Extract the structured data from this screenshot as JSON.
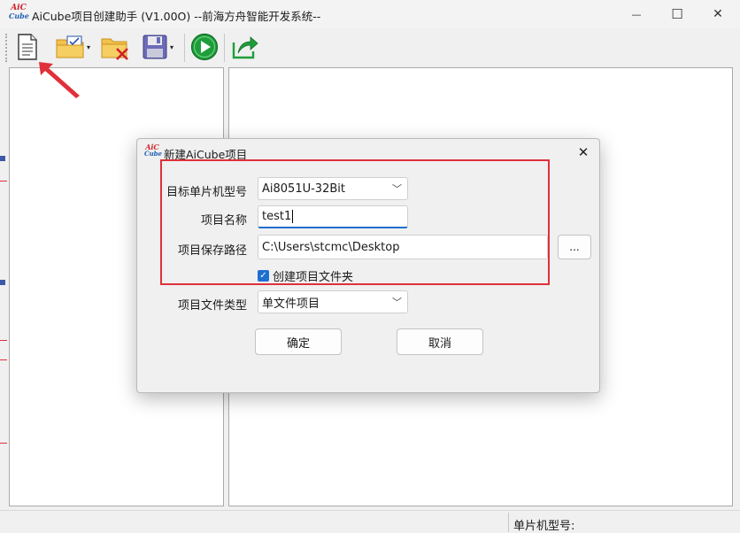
{
  "window": {
    "title": "AiCube项目创建助手 (V1.00O) --前海方舟智能开发系统--",
    "logo_text_top": "AiC",
    "logo_text_bottom": "Cube",
    "minimize_glyph": "—",
    "maximize_glyph": "☐",
    "close_glyph": "✕"
  },
  "toolbar": {
    "icons": [
      "new-file-icon",
      "open-folder-icon",
      "delete-folder-icon",
      "save-icon",
      "run-icon",
      "export-icon"
    ],
    "dropdown_glyph": "▾",
    "accent_green": "#1e9e3a",
    "folder_yellow": "#f2c14e"
  },
  "dialog": {
    "title": "新建AiCube项目",
    "logo_text_top": "AiC",
    "logo_text_bottom": "Cube",
    "close_glyph": "✕",
    "fields": {
      "target_mcu_label": "目标单片机型号",
      "target_mcu_value": "Ai8051U-32Bit",
      "project_name_label": "项目名称",
      "project_name_value": "test1",
      "save_path_label": "项目保存路径",
      "save_path_value": "C:\\Users\\stcmc\\Desktop",
      "browse_label": "...",
      "create_folder_label": "创建项目文件夹",
      "create_folder_checked": true,
      "file_type_label": "项目文件类型",
      "file_type_value": "单文件项目"
    },
    "ok_label": "确定",
    "cancel_label": "取消",
    "highlight_color": "#e0303a"
  },
  "statusbar": {
    "mcu_label": "单片机型号:"
  }
}
